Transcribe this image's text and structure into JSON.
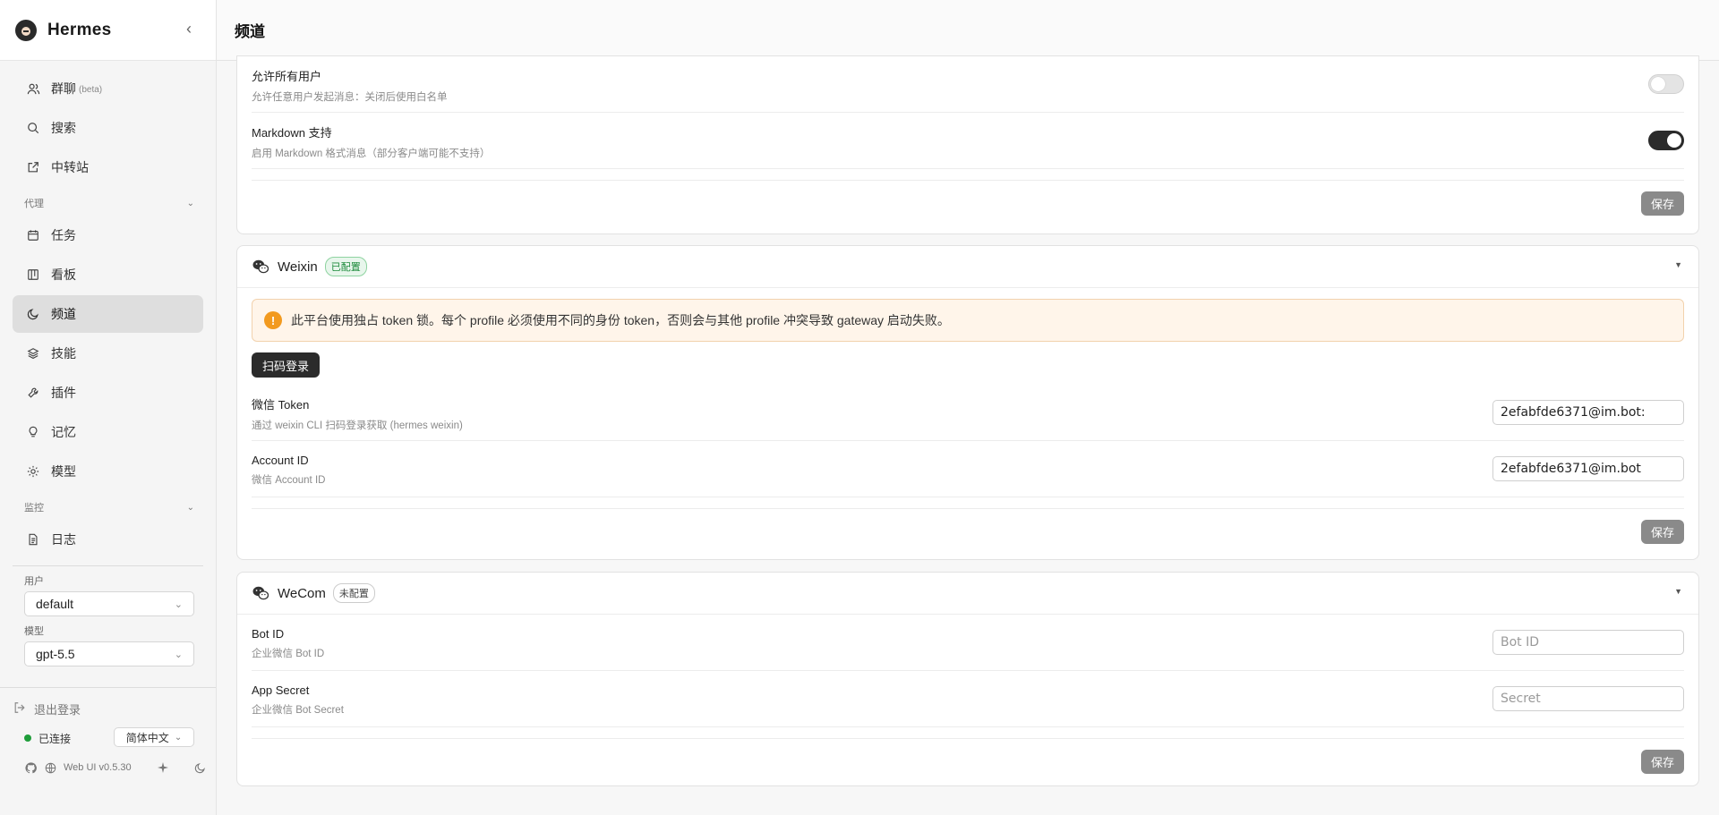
{
  "app": {
    "name": "Hermes"
  },
  "header": {
    "title": "频道"
  },
  "sidebar": {
    "nav_top": [
      {
        "label": "群聊",
        "suffix": "(beta)",
        "icon": "users-icon"
      },
      {
        "label": "搜索",
        "icon": "search-icon"
      },
      {
        "label": "中转站",
        "icon": "external-link-icon"
      }
    ],
    "section_agent": "代理",
    "nav_agent": [
      {
        "label": "任务",
        "icon": "calendar-icon"
      },
      {
        "label": "看板",
        "icon": "kanban-icon"
      },
      {
        "label": "频道",
        "icon": "moon-icon",
        "active": true
      },
      {
        "label": "技能",
        "icon": "layers-icon"
      },
      {
        "label": "插件",
        "icon": "wrench-icon"
      },
      {
        "label": "记忆",
        "icon": "lightbulb-icon"
      },
      {
        "label": "模型",
        "icon": "sun-icon"
      }
    ],
    "section_monitor": "监控",
    "nav_monitor": [
      {
        "label": "日志",
        "icon": "file-icon"
      }
    ],
    "user_label": "用户",
    "user_value": "default",
    "model_label": "模型",
    "model_value": "gpt-5.5",
    "logout": "退出登录",
    "status": "已连接",
    "language": "简体中文",
    "version": "Web UI v0.5.30"
  },
  "cards": {
    "top": {
      "rows": [
        {
          "label": "允许所有用户",
          "desc": "允许任意用户发起消息：关闭后使用白名单",
          "toggle": false
        },
        {
          "label": "Markdown 支持",
          "desc": "启用 Markdown 格式消息（部分客户端可能不支持）",
          "toggle": true
        }
      ],
      "save": "保存"
    },
    "weixin": {
      "name": "Weixin",
      "badge": "已配置",
      "warning": "此平台使用独占 token 锁。每个 profile 必须使用不同的身份 token，否则会与其他 profile 冲突导致 gateway 启动失败。",
      "scan_button": "扫码登录",
      "rows": [
        {
          "label": "微信 Token",
          "desc": "通过 weixin CLI 扫码登录获取 (hermes weixin)",
          "value": "2efabfde6371@im.bot:"
        },
        {
          "label": "Account ID",
          "desc": "微信 Account ID",
          "value": "2efabfde6371@im.bot"
        }
      ],
      "save": "保存"
    },
    "wecom": {
      "name": "WeCom",
      "badge": "未配置",
      "rows": [
        {
          "label": "Bot ID",
          "desc": "企业微信 Bot ID",
          "placeholder": "Bot ID"
        },
        {
          "label": "App Secret",
          "desc": "企业微信 Bot Secret",
          "placeholder": "Secret"
        }
      ],
      "save": "保存"
    }
  },
  "colors": {
    "accent": "#2b2b2b",
    "success": "#1f9d3a",
    "warning": "#f29a1f",
    "active_bg": "#dedede"
  }
}
